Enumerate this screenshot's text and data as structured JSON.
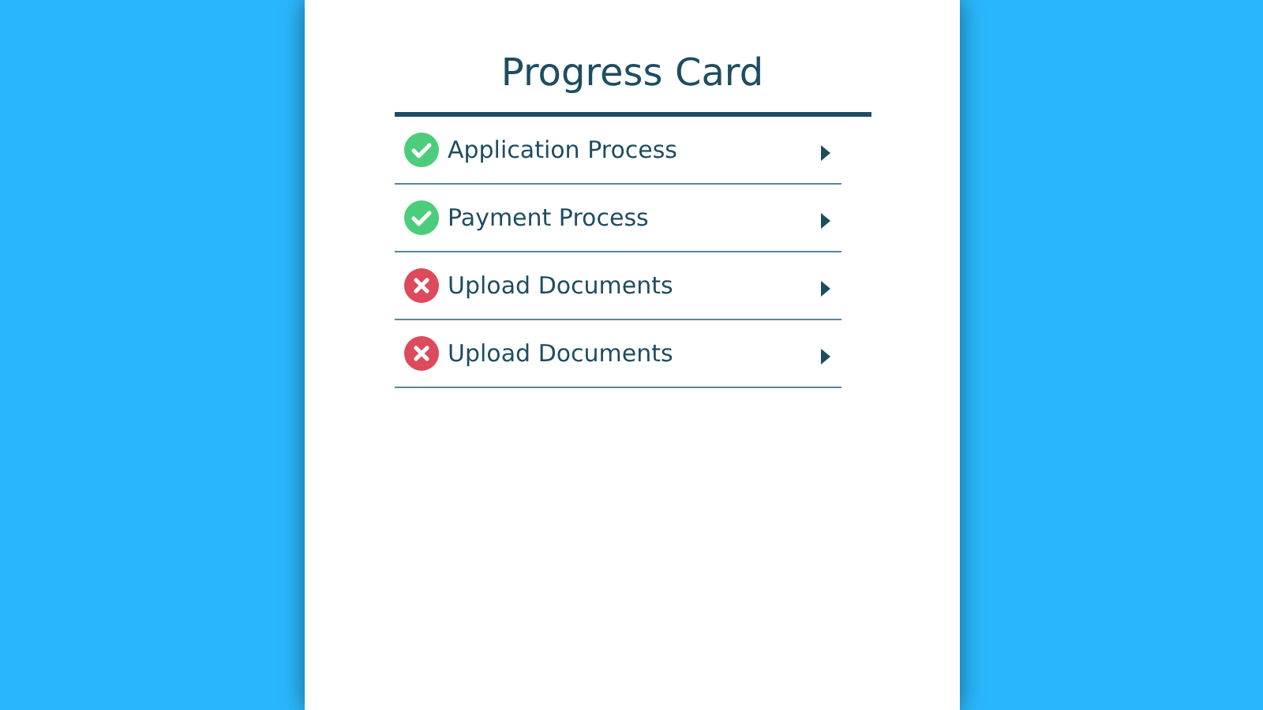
{
  "card": {
    "title": "Progress Card"
  },
  "steps": [
    {
      "label": "Application Process",
      "completed": true
    },
    {
      "label": "Payment Process",
      "completed": true
    },
    {
      "label": "Upload Documents",
      "completed": false
    },
    {
      "label": "Upload Documents",
      "completed": false
    }
  ]
}
